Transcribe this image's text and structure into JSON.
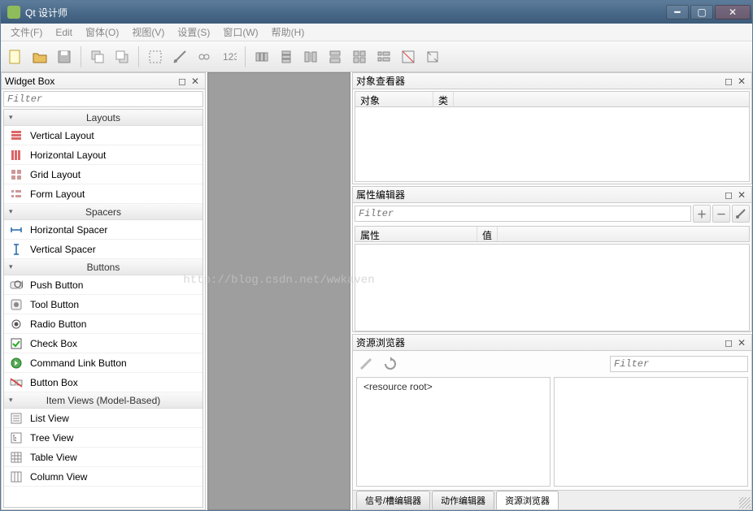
{
  "window": {
    "title": "Qt 设计师"
  },
  "menu": {
    "file": "文件(F)",
    "edit": "Edit",
    "form": "窗体(O)",
    "view": "视图(V)",
    "settings": "设置(S)",
    "window": "窗口(W)",
    "help": "帮助(H)"
  },
  "widgetbox": {
    "title": "Widget Box",
    "filter_placeholder": "Filter",
    "groups": [
      {
        "header": "Layouts",
        "items": [
          {
            "icon": "vlayout",
            "label": "Vertical Layout"
          },
          {
            "icon": "hlayout",
            "label": "Horizontal Layout"
          },
          {
            "icon": "grid",
            "label": "Grid Layout"
          },
          {
            "icon": "form",
            "label": "Form Layout"
          }
        ]
      },
      {
        "header": "Spacers",
        "items": [
          {
            "icon": "hspacer",
            "label": "Horizontal Spacer"
          },
          {
            "icon": "vspacer",
            "label": "Vertical Spacer"
          }
        ]
      },
      {
        "header": "Buttons",
        "items": [
          {
            "icon": "pushbtn",
            "label": "Push Button"
          },
          {
            "icon": "toolbtn",
            "label": "Tool Button"
          },
          {
            "icon": "radio",
            "label": "Radio Button"
          },
          {
            "icon": "check",
            "label": "Check Box"
          },
          {
            "icon": "cmdlink",
            "label": "Command Link Button"
          },
          {
            "icon": "btnbox",
            "label": "Button Box"
          }
        ]
      },
      {
        "header": "Item Views (Model-Based)",
        "items": [
          {
            "icon": "listview",
            "label": "List View"
          },
          {
            "icon": "treeview",
            "label": "Tree View"
          },
          {
            "icon": "tableview",
            "label": "Table View"
          },
          {
            "icon": "colview",
            "label": "Column View"
          }
        ]
      }
    ]
  },
  "objinspector": {
    "title": "对象查看器",
    "col_object": "对象",
    "col_class": "类"
  },
  "propeditor": {
    "title": "属性编辑器",
    "filter_placeholder": "Filter",
    "col_prop": "属性",
    "col_val": "值"
  },
  "resbrowser": {
    "title": "资源浏览器",
    "filter_placeholder": "Filter",
    "root": "<resource root>"
  },
  "tabs": {
    "signal": "信号/槽编辑器",
    "action": "动作编辑器",
    "resource": "资源浏览器"
  },
  "watermark": "http://blog.csdn.net/wwkaven"
}
